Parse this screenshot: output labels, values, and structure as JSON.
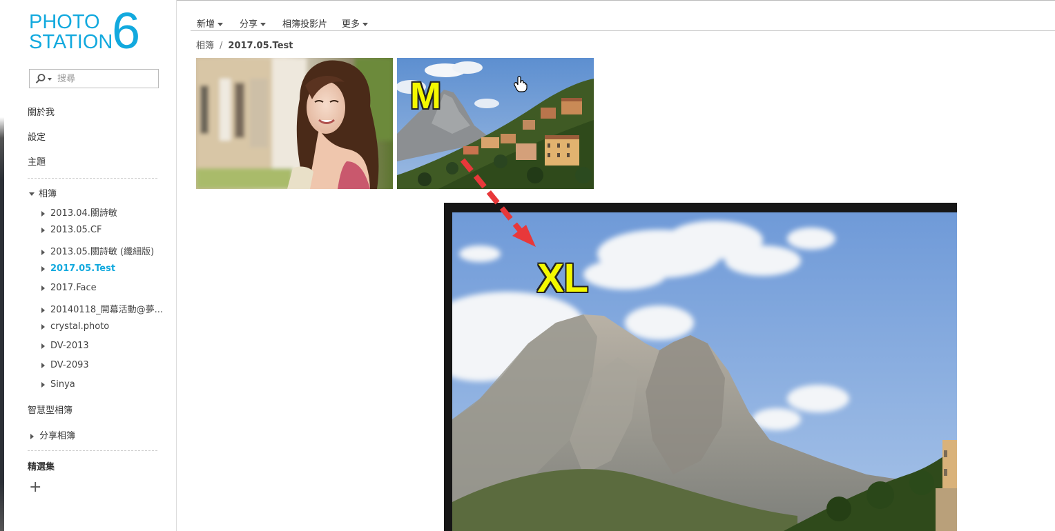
{
  "app": {
    "logo_line1": "PHOTO",
    "logo_line2": "STATION",
    "logo_version": "6",
    "brand_color": "#12a9de"
  },
  "search": {
    "placeholder": "搜尋",
    "icon": "search-icon"
  },
  "sidebar": {
    "top_items": [
      "關於我",
      "設定",
      "主題"
    ],
    "albums_label": "相簿",
    "albums": [
      {
        "label": "2013.04.關詩敏",
        "active": false
      },
      {
        "label": "2013.05.CF",
        "active": false
      },
      {
        "label": "2013.05.關詩敏 (纖細版)",
        "active": false
      },
      {
        "label": "2017.05.Test",
        "active": true
      },
      {
        "label": "2017.Face",
        "active": false
      },
      {
        "label": "20140118_開幕活動@夢...",
        "active": false
      },
      {
        "label": "crystal.photo",
        "active": false
      },
      {
        "label": "DV-2013",
        "active": false
      },
      {
        "label": "DV-2093",
        "active": false
      },
      {
        "label": "Sinya",
        "active": false
      }
    ],
    "smart_albums_label": "智慧型相簿",
    "shared_albums_label": "分享相簿",
    "collections_label": "精選集",
    "add_icon": "plus-icon"
  },
  "toolbar": {
    "new_label": "新增",
    "share_label": "分享",
    "slideshow_label": "相簿投影片",
    "more_label": "更多"
  },
  "breadcrumb": {
    "root": "相簿",
    "separator": "/",
    "current": "2017.05.Test"
  },
  "annotations": {
    "medium_label": "M",
    "xlarge_label": "XL",
    "label_color": "#f4f800",
    "arrow_color": "#e8383a"
  }
}
